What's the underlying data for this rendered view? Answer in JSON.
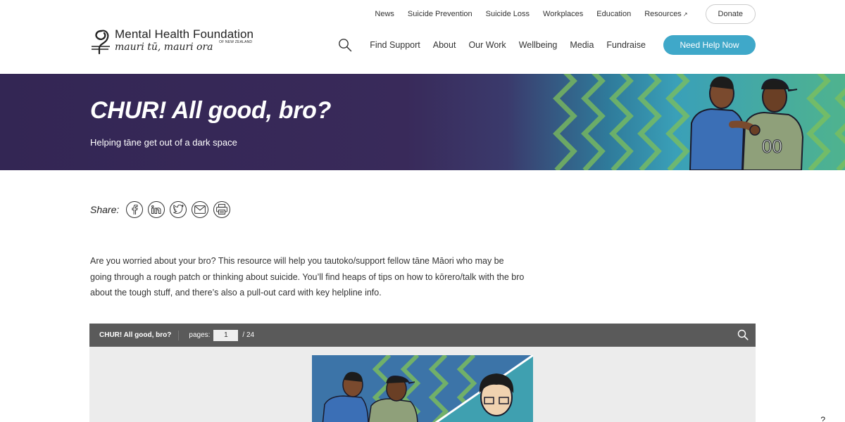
{
  "top_nav": {
    "items": [
      "News",
      "Suicide Prevention",
      "Suicide Loss",
      "Workplaces",
      "Education",
      "Resources"
    ],
    "donate": "Donate"
  },
  "logo": {
    "title": "Mental Health Foundation",
    "subtitle": "mauri tū, mauri ora",
    "country": "OF NEW ZEALAND"
  },
  "main_nav": {
    "items": [
      "Find Support",
      "About",
      "Our Work",
      "Wellbeing",
      "Media",
      "Fundraise"
    ],
    "help_button": "Need Help Now"
  },
  "hero": {
    "title": "CHUR! All good, bro?",
    "subtitle": "Helping tāne get out of a dark space"
  },
  "share": {
    "label": "Share:",
    "icons": [
      "facebook-icon",
      "linkedin-icon",
      "twitter-icon",
      "email-icon",
      "print-icon"
    ]
  },
  "intro": {
    "text": "Are you worried about your bro? This resource will help you tautoko/support fellow tāne Māori who may be going through a rough patch or thinking about suicide. You’ll find heaps of tips on how to kōrero/talk with the bro about the tough stuff, and there’s also a pull-out card with key helpline info."
  },
  "viewer": {
    "title": "CHUR! All good, bro?",
    "pages_label": "pages:",
    "current_page": "1",
    "total_pages": "/ 24"
  },
  "corner": "?",
  "colors": {
    "accent": "#3fa8c9",
    "hero_purple": "#332654",
    "viewer_bar": "#5a5a5a"
  }
}
